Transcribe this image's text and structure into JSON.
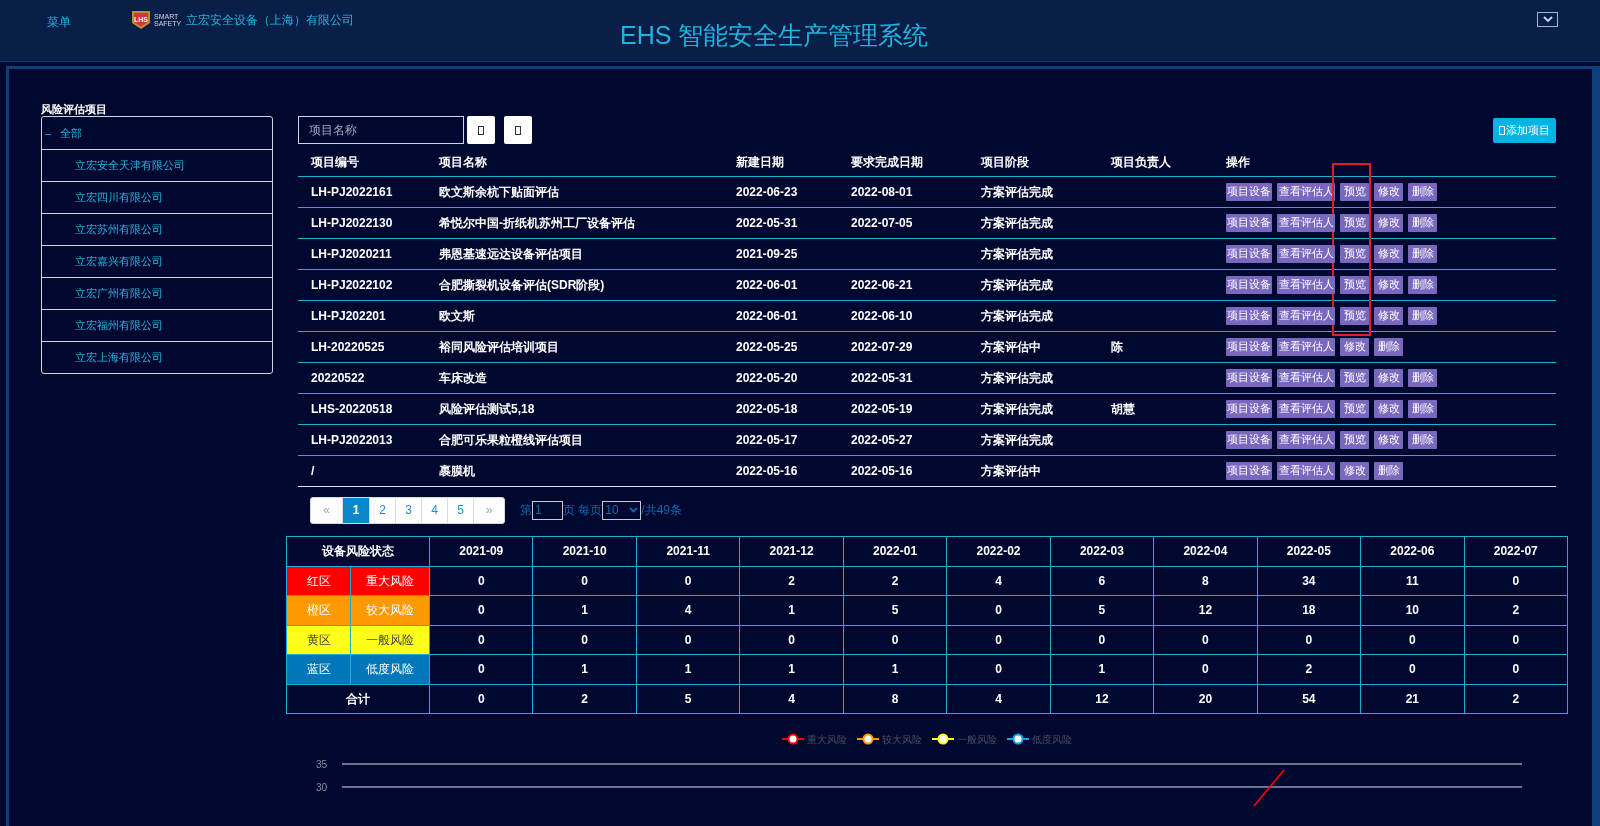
{
  "header": {
    "menu": "菜单",
    "logo": {
      "mark": "LHS",
      "line_1": "SMART",
      "line_2": "SAFETY"
    },
    "company": "立宏安全设备（上海）有限公司",
    "title": "EHS 智能安全生产管理系统"
  },
  "sidebar": {
    "title": "风险评估项目",
    "tree": [
      {
        "label": "全部",
        "toggle": "–",
        "expanded": true,
        "children": [
          {
            "label": "立宏安全天津有限公司"
          },
          {
            "label": "立宏四川有限公司"
          },
          {
            "label": "立宏苏州有限公司"
          },
          {
            "label": "立宏嘉兴有限公司"
          },
          {
            "label": "立宏广州有限公司"
          },
          {
            "label": "立宏福州有限公司"
          },
          {
            "label": "立宏上海有限公司"
          }
        ]
      }
    ]
  },
  "toolbar": {
    "search": {
      "placeholder": "项目名称"
    },
    "add_button": "添加项目"
  },
  "projects": {
    "columns": [
      "项目编号",
      "项目名称",
      "新建日期",
      "要求完成日期",
      "项目阶段",
      "项目负责人",
      "操作"
    ],
    "rows": [
      {
        "cells": [
          "LH-PJ2022161",
          "欧文斯余杭下贴面评估",
          "2022-06-23",
          "2022-08-01",
          "方案评估完成",
          ""
        ],
        "actions": [
          "项目设备",
          "查看评估人",
          "预览",
          "修改",
          "删除"
        ],
        "highlighted": true
      },
      {
        "cells": [
          "LH-PJ2022130",
          "希悦尔中国-折纸机苏州工厂设备评估",
          "2022-05-31",
          "2022-07-05",
          "方案评估完成",
          ""
        ],
        "actions": [
          "项目设备",
          "查看评估人",
          "预览",
          "修改",
          "删除"
        ],
        "highlighted": true
      },
      {
        "cells": [
          "LH-PJ2020211",
          "弗恩基速远达设备评估项目",
          "2021-09-25",
          "",
          "方案评估完成",
          ""
        ],
        "actions": [
          "项目设备",
          "查看评估人",
          "预览",
          "修改",
          "删除"
        ],
        "highlighted": true
      },
      {
        "cells": [
          "LH-PJ2022102",
          "合肥撕裂机设备评估(SDR阶段)",
          "2022-06-01",
          "2022-06-21",
          "方案评估完成",
          ""
        ],
        "actions": [
          "项目设备",
          "查看评估人",
          "预览",
          "修改",
          "删除"
        ],
        "highlighted": true
      },
      {
        "cells": [
          "LH-PJ202201",
          "欧文斯",
          "2022-06-01",
          "2022-06-10",
          "方案评估完成",
          ""
        ],
        "actions": [
          "项目设备",
          "查看评估人",
          "预览",
          "修改",
          "删除"
        ],
        "highlighted": true
      },
      {
        "cells": [
          "LH-20220525",
          "裕同风险评估培训项目",
          "2022-05-25",
          "2022-07-29",
          "方案评估中",
          "陈"
        ],
        "actions": [
          "项目设备",
          "查看评估人",
          "修改",
          "删除"
        ],
        "highlighted": false
      },
      {
        "cells": [
          "20220522",
          "车床改造",
          "2022-05-20",
          "2022-05-31",
          "方案评估完成",
          ""
        ],
        "actions": [
          "项目设备",
          "查看评估人",
          "预览",
          "修改",
          "删除"
        ],
        "highlighted": false
      },
      {
        "cells": [
          "LHS-20220518",
          "风险评估测试5,18",
          "2022-05-18",
          "2022-05-19",
          "方案评估完成",
          "胡慧"
        ],
        "actions": [
          "项目设备",
          "查看评估人",
          "预览",
          "修改",
          "删除"
        ],
        "highlighted": false
      },
      {
        "cells": [
          "LH-PJ2022013",
          "合肥可乐果粒橙线评估项目",
          "2022-05-17",
          "2022-05-27",
          "方案评估完成",
          ""
        ],
        "actions": [
          "项目设备",
          "查看评估人",
          "预览",
          "修改",
          "删除"
        ],
        "highlighted": false
      },
      {
        "cells": [
          "/",
          "裹膜机",
          "2022-05-16",
          "2022-05-16",
          "方案评估中",
          ""
        ],
        "actions": [
          "项目设备",
          "查看评估人",
          "修改",
          "删除"
        ],
        "highlighted": false
      }
    ]
  },
  "pagination": {
    "pages": [
      {
        "label": "«",
        "selected": false
      },
      {
        "label": "1",
        "selected": true
      },
      {
        "label": "2",
        "selected": false
      },
      {
        "label": "3",
        "selected": false
      },
      {
        "label": "4",
        "selected": false
      },
      {
        "label": "5",
        "selected": false
      },
      {
        "label": "»",
        "selected": false
      }
    ],
    "page_prefix": "第",
    "page_value": "1",
    "page_suffix": "页 每页",
    "page_size": "10",
    "total": "/共49条"
  },
  "risk_table": {
    "header": "设备风险状态",
    "months": [
      "2021-09",
      "2021-10",
      "2021-11",
      "2021-12",
      "2022-01",
      "2022-02",
      "2022-03",
      "2022-04",
      "2022-05",
      "2022-06",
      "2022-07"
    ],
    "rows": [
      {
        "zone": "红区",
        "level": "重大风险",
        "color": "#ff0000",
        "values": [
          "0",
          "0",
          "0",
          "2",
          "2",
          "4",
          "6",
          "8",
          "34",
          "11",
          "0"
        ]
      },
      {
        "zone": "橙区",
        "level": "较大风险",
        "color": "#ff9900",
        "values": [
          "0",
          "1",
          "4",
          "1",
          "5",
          "0",
          "5",
          "12",
          "18",
          "10",
          "2"
        ]
      },
      {
        "zone": "黄区",
        "level": "一般风险",
        "color": "#ffff1a",
        "values": [
          "0",
          "0",
          "0",
          "0",
          "0",
          "0",
          "0",
          "0",
          "0",
          "0",
          "0"
        ]
      },
      {
        "zone": "蓝区",
        "level": "低度风险",
        "color": "#0077b8",
        "values": [
          "0",
          "1",
          "1",
          "1",
          "1",
          "0",
          "1",
          "0",
          "2",
          "0",
          "0"
        ]
      }
    ],
    "total": {
      "label": "合计",
      "values": [
        "0",
        "2",
        "5",
        "4",
        "8",
        "4",
        "12",
        "20",
        "54",
        "21",
        "2"
      ]
    }
  },
  "trend_chart": {
    "legend": [
      {
        "name": "重大风险",
        "color": "#ff0000"
      },
      {
        "name": "较大风险",
        "color": "#ff9900"
      },
      {
        "name": "一般风险",
        "color": "#ffff1a"
      },
      {
        "name": "低度风险",
        "color": "#0aa6e8"
      }
    ],
    "y_tick_labels": [
      "35",
      "30"
    ]
  }
}
